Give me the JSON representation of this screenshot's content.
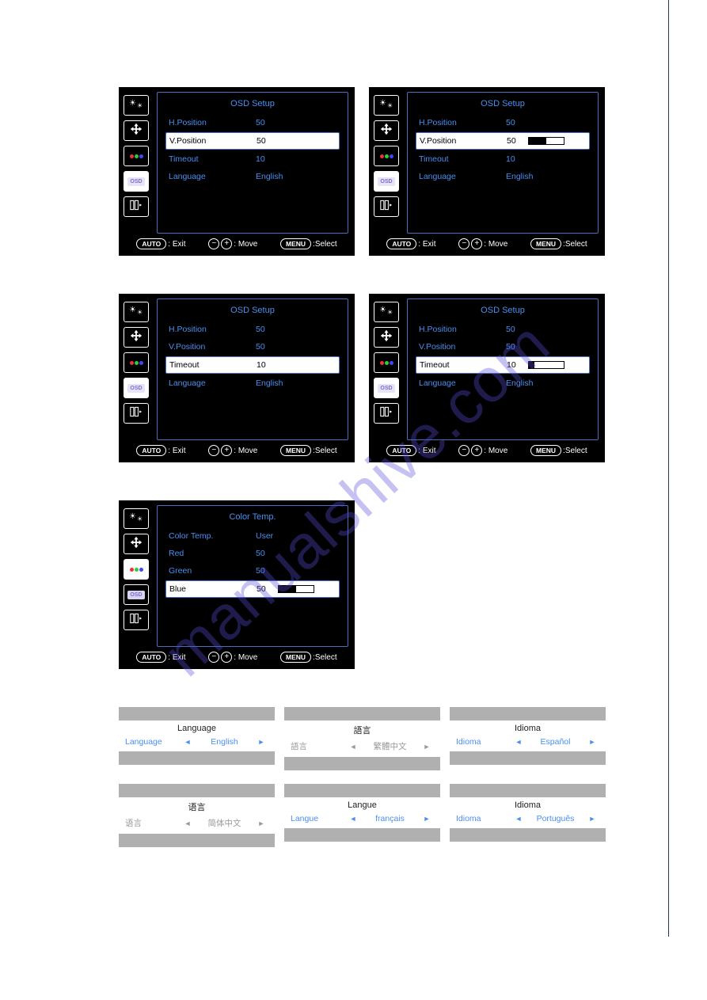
{
  "watermark": "manualshive.com",
  "footer": {
    "auto": "AUTO",
    "exit": ": Exit",
    "move": ": Move",
    "menu": "MENU",
    "select": ":Select"
  },
  "panels": {
    "osd1": {
      "title": "OSD Setup",
      "rows": [
        {
          "label": "H.Position",
          "value": "50",
          "selected": false
        },
        {
          "label": "V.Position",
          "value": "50",
          "selected": true,
          "slider": false
        },
        {
          "label": "Timeout",
          "value": "10",
          "selected": false
        },
        {
          "label": "Language",
          "value": "English",
          "selected": false
        }
      ],
      "activeTab": 3
    },
    "osd2": {
      "title": "OSD Setup",
      "rows": [
        {
          "label": "H.Position",
          "value": "50",
          "selected": false
        },
        {
          "label": "V.Position",
          "value": "50",
          "selected": true,
          "slider": true,
          "fill": 50
        },
        {
          "label": "Timeout",
          "value": "10",
          "selected": false
        },
        {
          "label": "Language",
          "value": "English",
          "selected": false
        }
      ],
      "activeTab": 3
    },
    "osd3": {
      "title": "OSD Setup",
      "rows": [
        {
          "label": "H.Position",
          "value": "50",
          "selected": false
        },
        {
          "label": "V.Position",
          "value": "50",
          "selected": false
        },
        {
          "label": "Timeout",
          "value": "10",
          "selected": true,
          "slider": false
        },
        {
          "label": "Language",
          "value": "English",
          "selected": false
        }
      ],
      "activeTab": 3
    },
    "osd4": {
      "title": "OSD Setup",
      "rows": [
        {
          "label": "H.Position",
          "value": "50",
          "selected": false
        },
        {
          "label": "V.Position",
          "value": "50",
          "selected": false
        },
        {
          "label": "Timeout",
          "value": "10",
          "selected": true,
          "slider": true,
          "fill": 15
        },
        {
          "label": "Language",
          "value": "English",
          "selected": false
        }
      ],
      "activeTab": 3
    },
    "color": {
      "title": "Color Temp.",
      "rows": [
        {
          "label": "Color Temp.",
          "value": "User",
          "selected": false
        },
        {
          "label": "Red",
          "value": "50",
          "selected": false
        },
        {
          "label": "Green",
          "value": "50",
          "selected": false
        },
        {
          "label": "Blue",
          "value": "50",
          "selected": true,
          "slider": true,
          "fill": 50
        }
      ],
      "activeTab": 2
    }
  },
  "languages": [
    {
      "title": "Language",
      "label": "Language",
      "value": "English",
      "grey": false
    },
    {
      "title": "語言",
      "label": "語言",
      "value": "繁體中文",
      "grey": true
    },
    {
      "title": "Idioma",
      "label": "Idioma",
      "value": "Español",
      "grey": false
    },
    {
      "title": "语言",
      "label": "语言",
      "value": "简体中文",
      "grey": true
    },
    {
      "title": "Langue",
      "label": "Langue",
      "value": "français",
      "grey": false
    },
    {
      "title": "Idioma",
      "label": "Idioma",
      "value": "Português",
      "grey": false
    }
  ],
  "tabIcons": [
    "brightness",
    "arrows",
    "rgb",
    "osd",
    "extra"
  ],
  "osdIconText": "OSD"
}
